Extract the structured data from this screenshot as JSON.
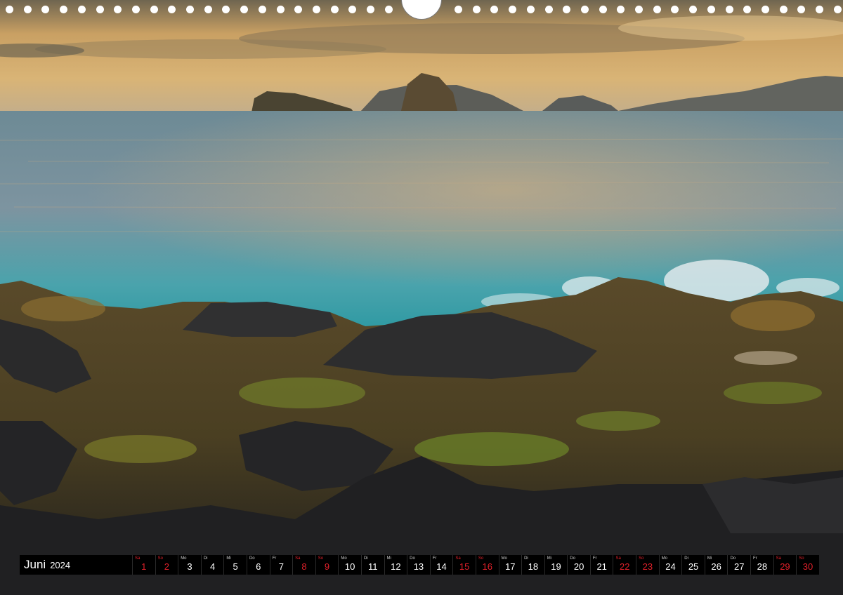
{
  "calendar": {
    "month": "Juni",
    "year": "2024",
    "days": [
      {
        "wd": "Sa",
        "d": "1",
        "weekend": true
      },
      {
        "wd": "So",
        "d": "2",
        "weekend": true
      },
      {
        "wd": "Mo",
        "d": "3",
        "weekend": false
      },
      {
        "wd": "Di",
        "d": "4",
        "weekend": false
      },
      {
        "wd": "Mi",
        "d": "5",
        "weekend": false
      },
      {
        "wd": "Do",
        "d": "6",
        "weekend": false
      },
      {
        "wd": "Fr",
        "d": "7",
        "weekend": false
      },
      {
        "wd": "Sa",
        "d": "8",
        "weekend": true
      },
      {
        "wd": "So",
        "d": "9",
        "weekend": true
      },
      {
        "wd": "Mo",
        "d": "10",
        "weekend": false
      },
      {
        "wd": "Di",
        "d": "11",
        "weekend": false
      },
      {
        "wd": "Mi",
        "d": "12",
        "weekend": false
      },
      {
        "wd": "Do",
        "d": "13",
        "weekend": false
      },
      {
        "wd": "Fr",
        "d": "14",
        "weekend": false
      },
      {
        "wd": "Sa",
        "d": "15",
        "weekend": true
      },
      {
        "wd": "So",
        "d": "16",
        "weekend": true
      },
      {
        "wd": "Mo",
        "d": "17",
        "weekend": false
      },
      {
        "wd": "Di",
        "d": "18",
        "weekend": false
      },
      {
        "wd": "Mi",
        "d": "19",
        "weekend": false
      },
      {
        "wd": "Do",
        "d": "20",
        "weekend": false
      },
      {
        "wd": "Fr",
        "d": "21",
        "weekend": false
      },
      {
        "wd": "Sa",
        "d": "22",
        "weekend": true
      },
      {
        "wd": "So",
        "d": "23",
        "weekend": true
      },
      {
        "wd": "Mo",
        "d": "24",
        "weekend": false
      },
      {
        "wd": "Di",
        "d": "25",
        "weekend": false
      },
      {
        "wd": "Mi",
        "d": "26",
        "weekend": false
      },
      {
        "wd": "Do",
        "d": "27",
        "weekend": false
      },
      {
        "wd": "Fr",
        "d": "28",
        "weekend": false
      },
      {
        "wd": "Sa",
        "d": "29",
        "weekend": true
      },
      {
        "wd": "So",
        "d": "30",
        "weekend": true
      }
    ]
  },
  "colors": {
    "weekend": "#e0202a",
    "strip_background": "#000000"
  },
  "photo": {
    "subject": "coastal-rocks-at-sunset"
  }
}
